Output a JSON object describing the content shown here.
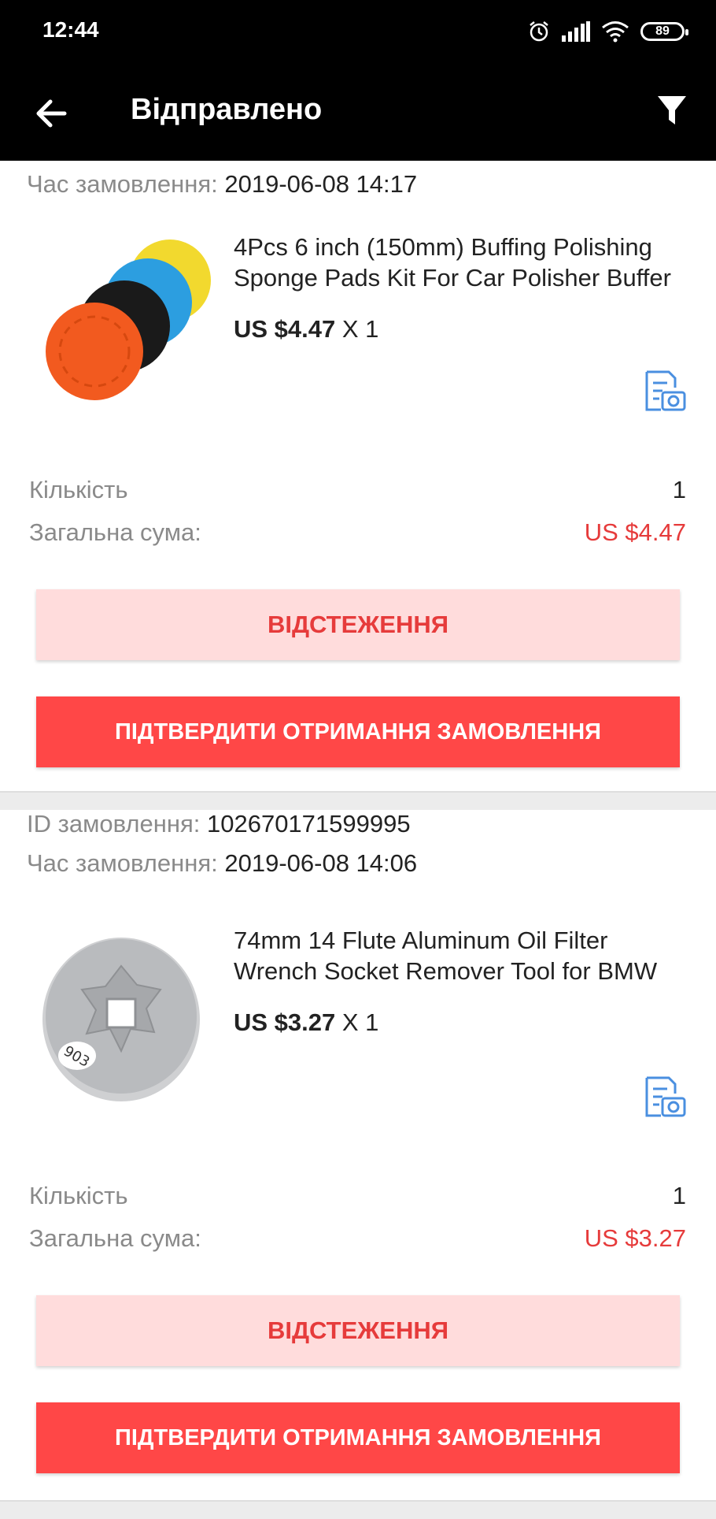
{
  "status_bar": {
    "time": "12:44",
    "battery": "89"
  },
  "app_bar": {
    "title": "Відправлено"
  },
  "labels": {
    "order_id": "ID замовлення:",
    "order_time": "Час замовлення:",
    "quantity": "Кількість",
    "total": "Загальна сума:",
    "track_button": "ВІДСТЕЖЕННЯ",
    "confirm_button": "ПІДТВЕРДИТИ ОТРИМАННЯ ЗАМОВЛЕННЯ"
  },
  "orders": [
    {
      "time": "2019-06-08 14:17",
      "product_title": "4Pcs 6 inch (150mm) Buffing Polishing Sponge Pads Kit For Car Polisher Buffer",
      "price": "US $4.47",
      "qty_suffix": "X 1",
      "quantity": "1",
      "total": "US $4.47"
    },
    {
      "id": "102670171599995",
      "time": "2019-06-08 14:06",
      "product_title": "74mm 14 Flute Aluminum Oil Filter Wrench Socket Remover Tool for BMW",
      "price": "US $3.27",
      "qty_suffix": "X 1",
      "quantity": "1",
      "total": "US $3.27",
      "image_text": "903"
    }
  ],
  "colors": {
    "accent": "#ff4747",
    "accent_light": "#ffdcdc",
    "price_red": "#e63b3b",
    "link_blue": "#4a8fe0"
  }
}
